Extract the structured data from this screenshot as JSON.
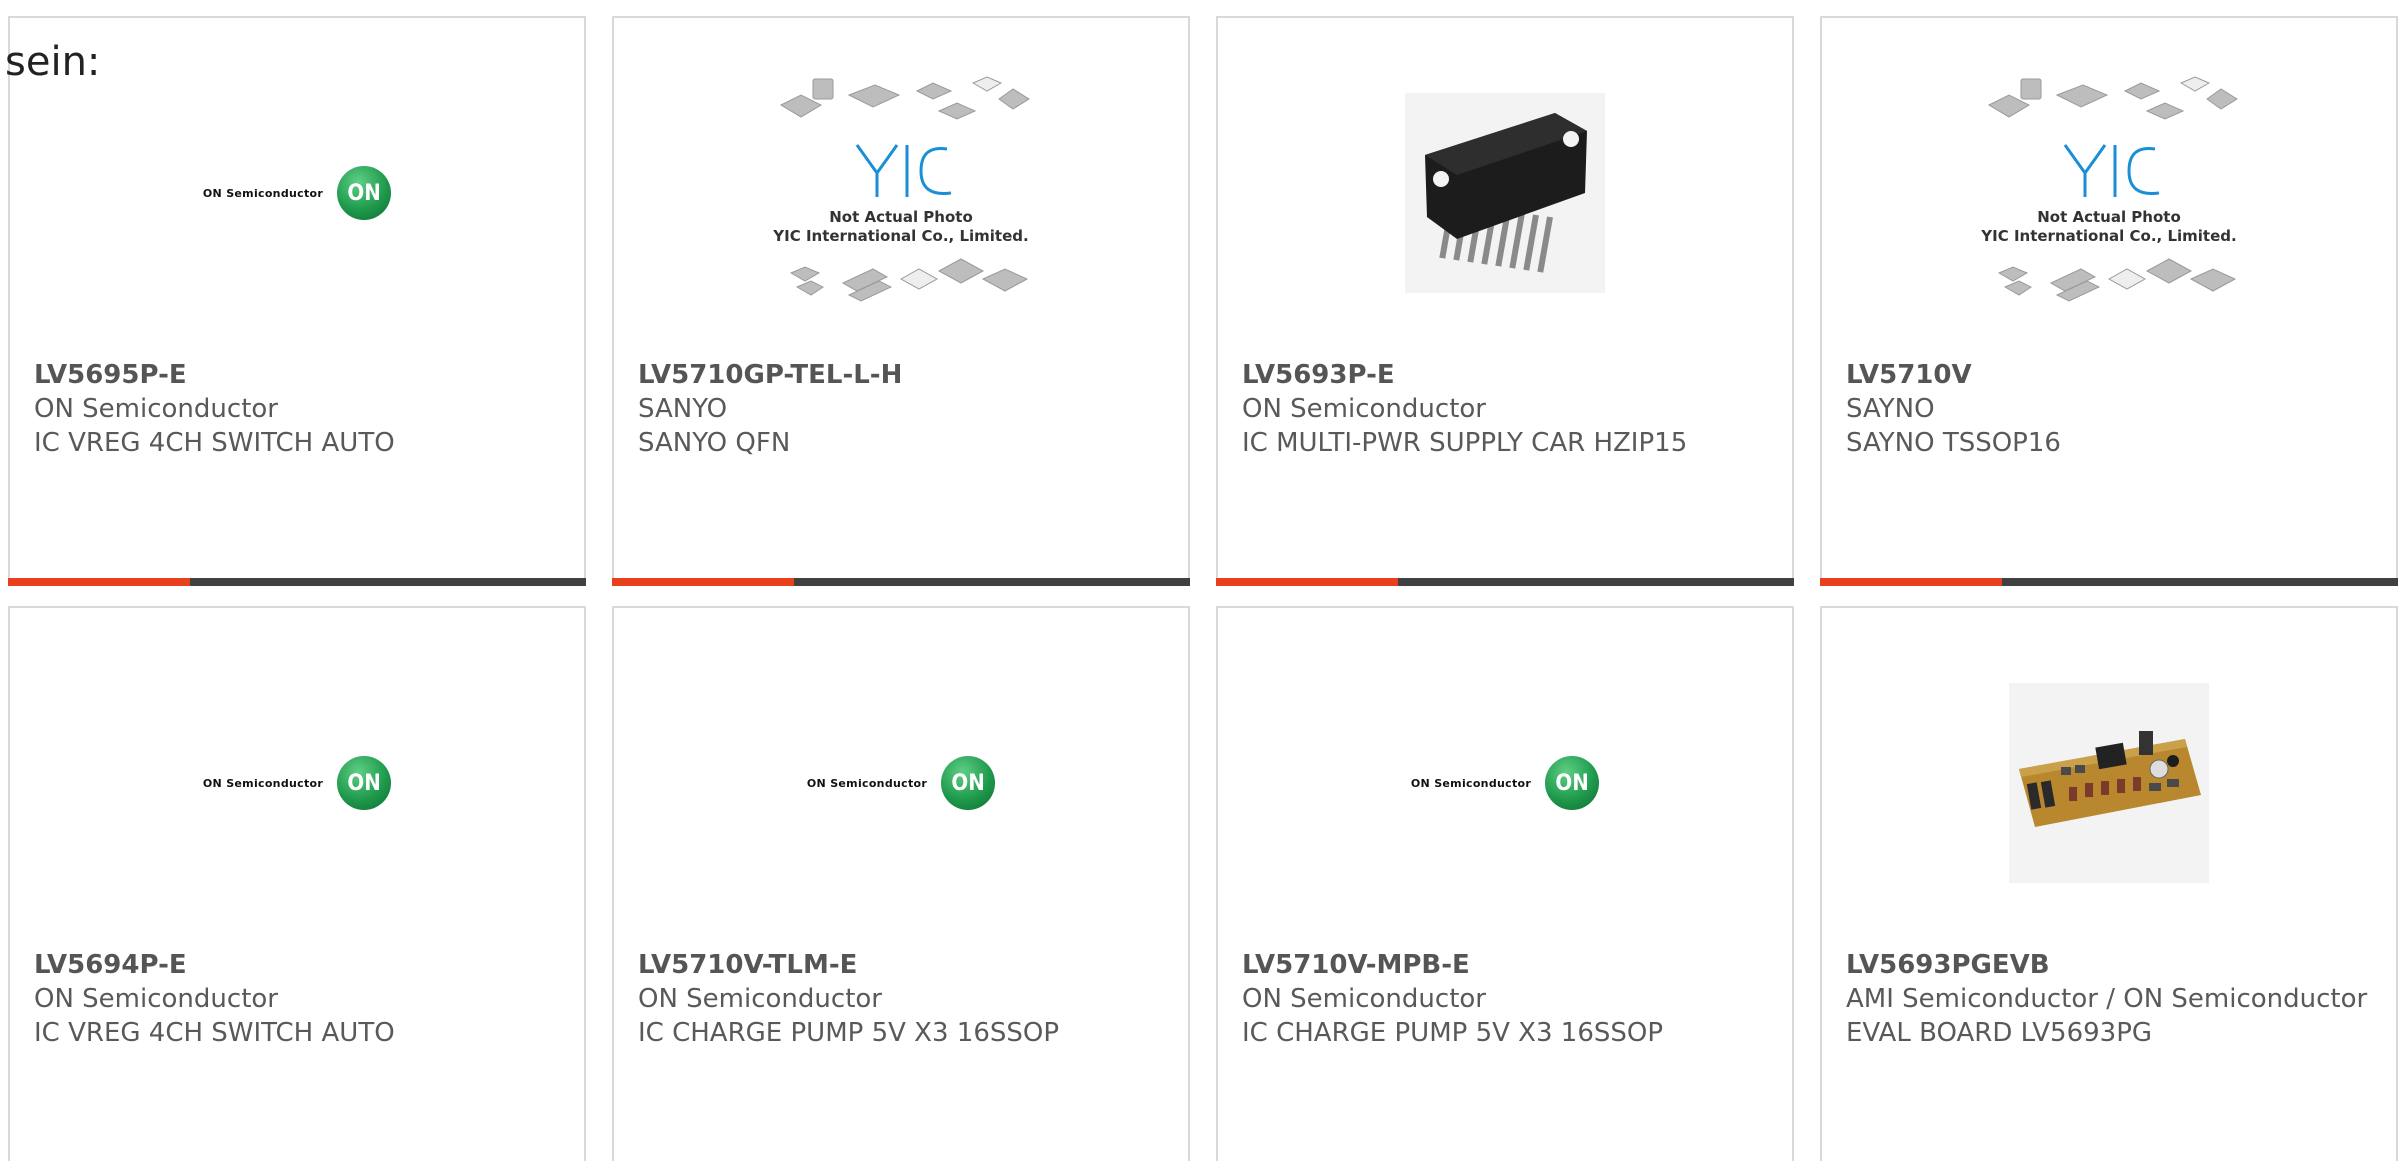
{
  "intro_text": "sein:",
  "accent_color": "#e8401c",
  "bar_color": "#404040",
  "yic_lines": [
    "Not Actual Photo",
    "YIC International Co., Limited."
  ],
  "on_logo_text": "ON Semiconductor",
  "on_logo_mark": "ON",
  "products": [
    {
      "part": "LV5695P-E",
      "manufacturer": "ON Semiconductor",
      "description": "IC VREG 4CH SWITCH AUTO",
      "image": "on-semiconductor-logo"
    },
    {
      "part": "LV5710GP-TEL-L-H",
      "manufacturer": "SANYO",
      "description": "SANYO QFN",
      "image": "yic-placeholder"
    },
    {
      "part": "LV5693P-E",
      "manufacturer": "ON Semiconductor",
      "description": "IC MULTI-PWR SUPPLY CAR HZIP15",
      "image": "chip-photo"
    },
    {
      "part": "LV5710V",
      "manufacturer": "SAYNO",
      "description": "SAYNO TSSOP16",
      "image": "yic-placeholder"
    },
    {
      "part": "LV5694P-E",
      "manufacturer": "ON Semiconductor",
      "description": "IC VREG 4CH SWITCH AUTO",
      "image": "on-semiconductor-logo"
    },
    {
      "part": "LV5710V-TLM-E",
      "manufacturer": "ON Semiconductor",
      "description": "IC CHARGE PUMP 5V X3 16SSOP",
      "image": "on-semiconductor-logo"
    },
    {
      "part": "LV5710V-MPB-E",
      "manufacturer": "ON Semiconductor",
      "description": "IC CHARGE PUMP 5V X3 16SSOP",
      "image": "on-semiconductor-logo"
    },
    {
      "part": "LV5693PGEVB",
      "manufacturer": "AMI Semiconductor / ON Semiconductor",
      "description": "EVAL BOARD LV5693PG",
      "image": "board-photo"
    }
  ]
}
